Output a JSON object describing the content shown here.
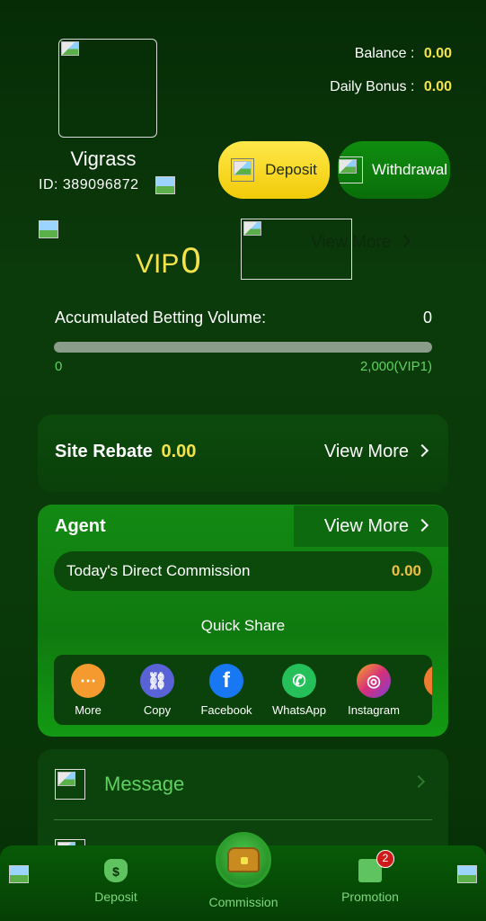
{
  "profile": {
    "username": "Vigrass",
    "id_label": "ID:",
    "id_value": "389096872"
  },
  "wallet": {
    "balance_label": "Balance :",
    "balance_value": "0.00",
    "bonus_label": "Daily Bonus :",
    "bonus_value": "0.00",
    "deposit_label": "Deposit",
    "withdraw_label": "Withdrawal"
  },
  "vip": {
    "label": "VIP",
    "level": "0",
    "view_more": "View More",
    "acc_label": "Accumulated Betting Volume:",
    "acc_value": "0",
    "progress": 0,
    "progress_min": "0",
    "progress_max": "2,000(VIP1)"
  },
  "rebate": {
    "label": "Site Rebate",
    "value": "0.00",
    "view_more": "View More"
  },
  "agent": {
    "title": "Agent",
    "view_more": "View More",
    "commission_label": "Today's Direct Commission",
    "commission_value": "0.00",
    "quick_share": "Quick Share",
    "share_items": [
      {
        "label": "More",
        "icon": "share-icon",
        "color": "#f59a2e"
      },
      {
        "label": "Copy",
        "icon": "link-icon",
        "color": "#5a63d6"
      },
      {
        "label": "Facebook",
        "icon": "facebook-icon",
        "color": "#1877f2"
      },
      {
        "label": "WhatsApp",
        "icon": "whatsapp-icon",
        "color": "#25c05a"
      },
      {
        "label": "Instagram",
        "icon": "instagram-icon",
        "color": "#d6307a"
      }
    ]
  },
  "message": {
    "label": "Message"
  },
  "nav": {
    "deposit": "Deposit",
    "commission": "Commission",
    "promotion": "Promotion",
    "promotion_badge": "2"
  }
}
